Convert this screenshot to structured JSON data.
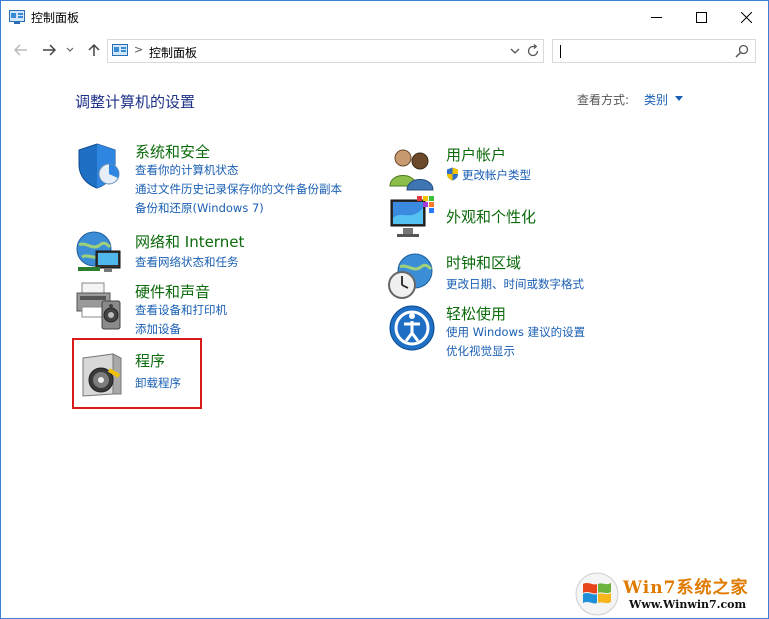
{
  "window": {
    "title": "控制面板"
  },
  "address": {
    "breadcrumb": "控制面板",
    "separator": ">"
  },
  "search": {
    "placeholder": ""
  },
  "header": {
    "title": "调整计算机的设置",
    "view_label": "查看方式:",
    "view_value": "类别"
  },
  "categories_left": [
    {
      "title": "系统和安全",
      "links": [
        "查看你的计算机状态",
        "通过文件历史记录保存你的文件备份副本",
        "备份和还原(Windows 7)"
      ]
    },
    {
      "title": "网络和 Internet",
      "links": [
        "查看网络状态和任务"
      ]
    },
    {
      "title": "硬件和声音",
      "links": [
        "查看设备和打印机",
        "添加设备"
      ]
    },
    {
      "title": "程序",
      "links": [
        "卸载程序"
      ]
    }
  ],
  "categories_right": [
    {
      "title": "用户帐户",
      "links": [
        "更改帐户类型"
      ]
    },
    {
      "title": "外观和个性化",
      "links": []
    },
    {
      "title": "时钟和区域",
      "links": [
        "更改日期、时间或数字格式"
      ]
    },
    {
      "title": "轻松使用",
      "links": [
        "使用 Windows 建议的设置",
        "优化视觉显示"
      ]
    }
  ],
  "watermark": {
    "brand": "Win7系统之家",
    "url": "Www.Winwin7.com"
  },
  "colors": {
    "category_title": "#0b6a0b",
    "link": "#1a5fb4",
    "highlight": "#d71a1a",
    "page_title": "#1e3287"
  }
}
